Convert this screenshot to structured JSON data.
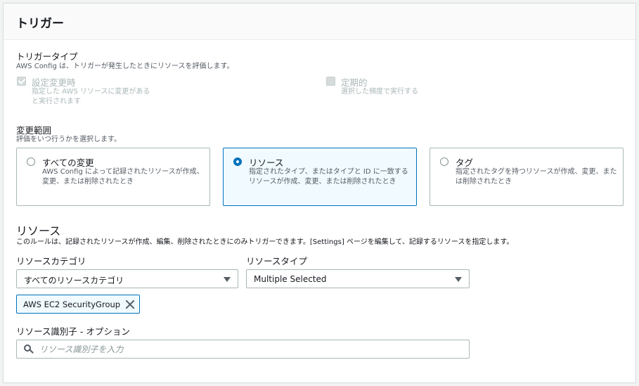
{
  "panel": {
    "title": "トリガー"
  },
  "trigger_type": {
    "label": "トリガータイプ",
    "description": "AWS Config は、トリガーが発生したときにリソースを評価します。",
    "options": [
      {
        "label": "設定変更時",
        "description_lines": [
          "指定した AWS リソースに変更がある",
          "と実行されます"
        ],
        "checked": true,
        "disabled": true
      },
      {
        "label": "定期的",
        "description_lines": [
          "選択した頻度で実行する"
        ],
        "checked": false,
        "disabled": true
      }
    ]
  },
  "scope": {
    "label": "変更範囲",
    "description": "評価をいつ行うかを選択します。",
    "tiles": [
      {
        "title": "すべての変更",
        "description": "AWS Config によって記録されたリソースが作成、変更、または削除されたとき",
        "selected": false
      },
      {
        "title": "リソース",
        "description": "指定されたタイプ、またはタイプと ID に一致するリソースが作成、変更、または削除されたとき",
        "selected": true
      },
      {
        "title": "タグ",
        "description": "指定されたタグを持つリソースが作成、変更、または削除されたとき",
        "selected": false
      }
    ]
  },
  "resources": {
    "heading": "リソース",
    "description": "このルールは、記録されたリソースが作成、編集、削除されたときにのみトリガーできます。[Settings] ページを編集して、記録するリソースを指定します。",
    "category_label": "リソースカテゴリ",
    "category_value": "すべてのリソースカテゴリ",
    "type_label": "リソースタイプ",
    "type_value": "Multiple Selected",
    "token": "AWS EC2 SecurityGroup"
  },
  "identifier": {
    "label": "リソース識別子 - オプション",
    "placeholder": "リソース識別子を入力"
  },
  "colors": {
    "accent": "#0073bb",
    "text": "#16191f",
    "secondary": "#545b64",
    "border": "#aab7b8"
  },
  "icons": {
    "search": "search-icon",
    "dropdown": "caret-down-icon",
    "remove": "close-icon"
  }
}
